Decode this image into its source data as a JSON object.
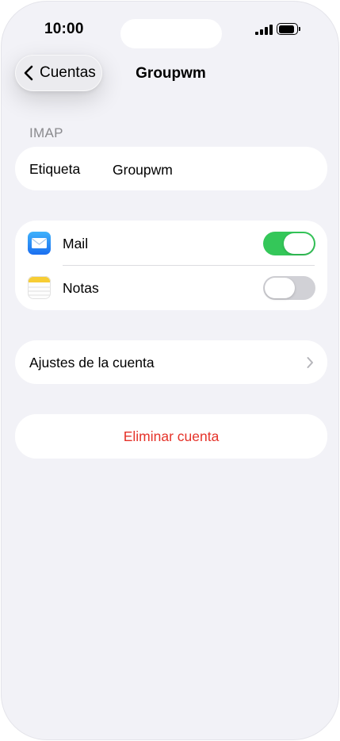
{
  "status_bar": {
    "time": "10:00"
  },
  "nav": {
    "back_label": "Cuentas",
    "title": "Groupwm"
  },
  "account": {
    "section_header": "IMAP",
    "label_field": "Etiqueta",
    "label_value": "Groupwm"
  },
  "services": [
    {
      "name": "Mail",
      "icon": "mail-app-icon",
      "enabled": true
    },
    {
      "name": "Notas",
      "icon": "notes-app-icon",
      "enabled": false
    }
  ],
  "settings": {
    "account_settings_label": "Ajustes de la cuenta"
  },
  "actions": {
    "delete_label": "Eliminar cuenta"
  },
  "colors": {
    "toggle_on": "#34c759",
    "destructive": "#e5332a",
    "background": "#f2f2f7"
  }
}
